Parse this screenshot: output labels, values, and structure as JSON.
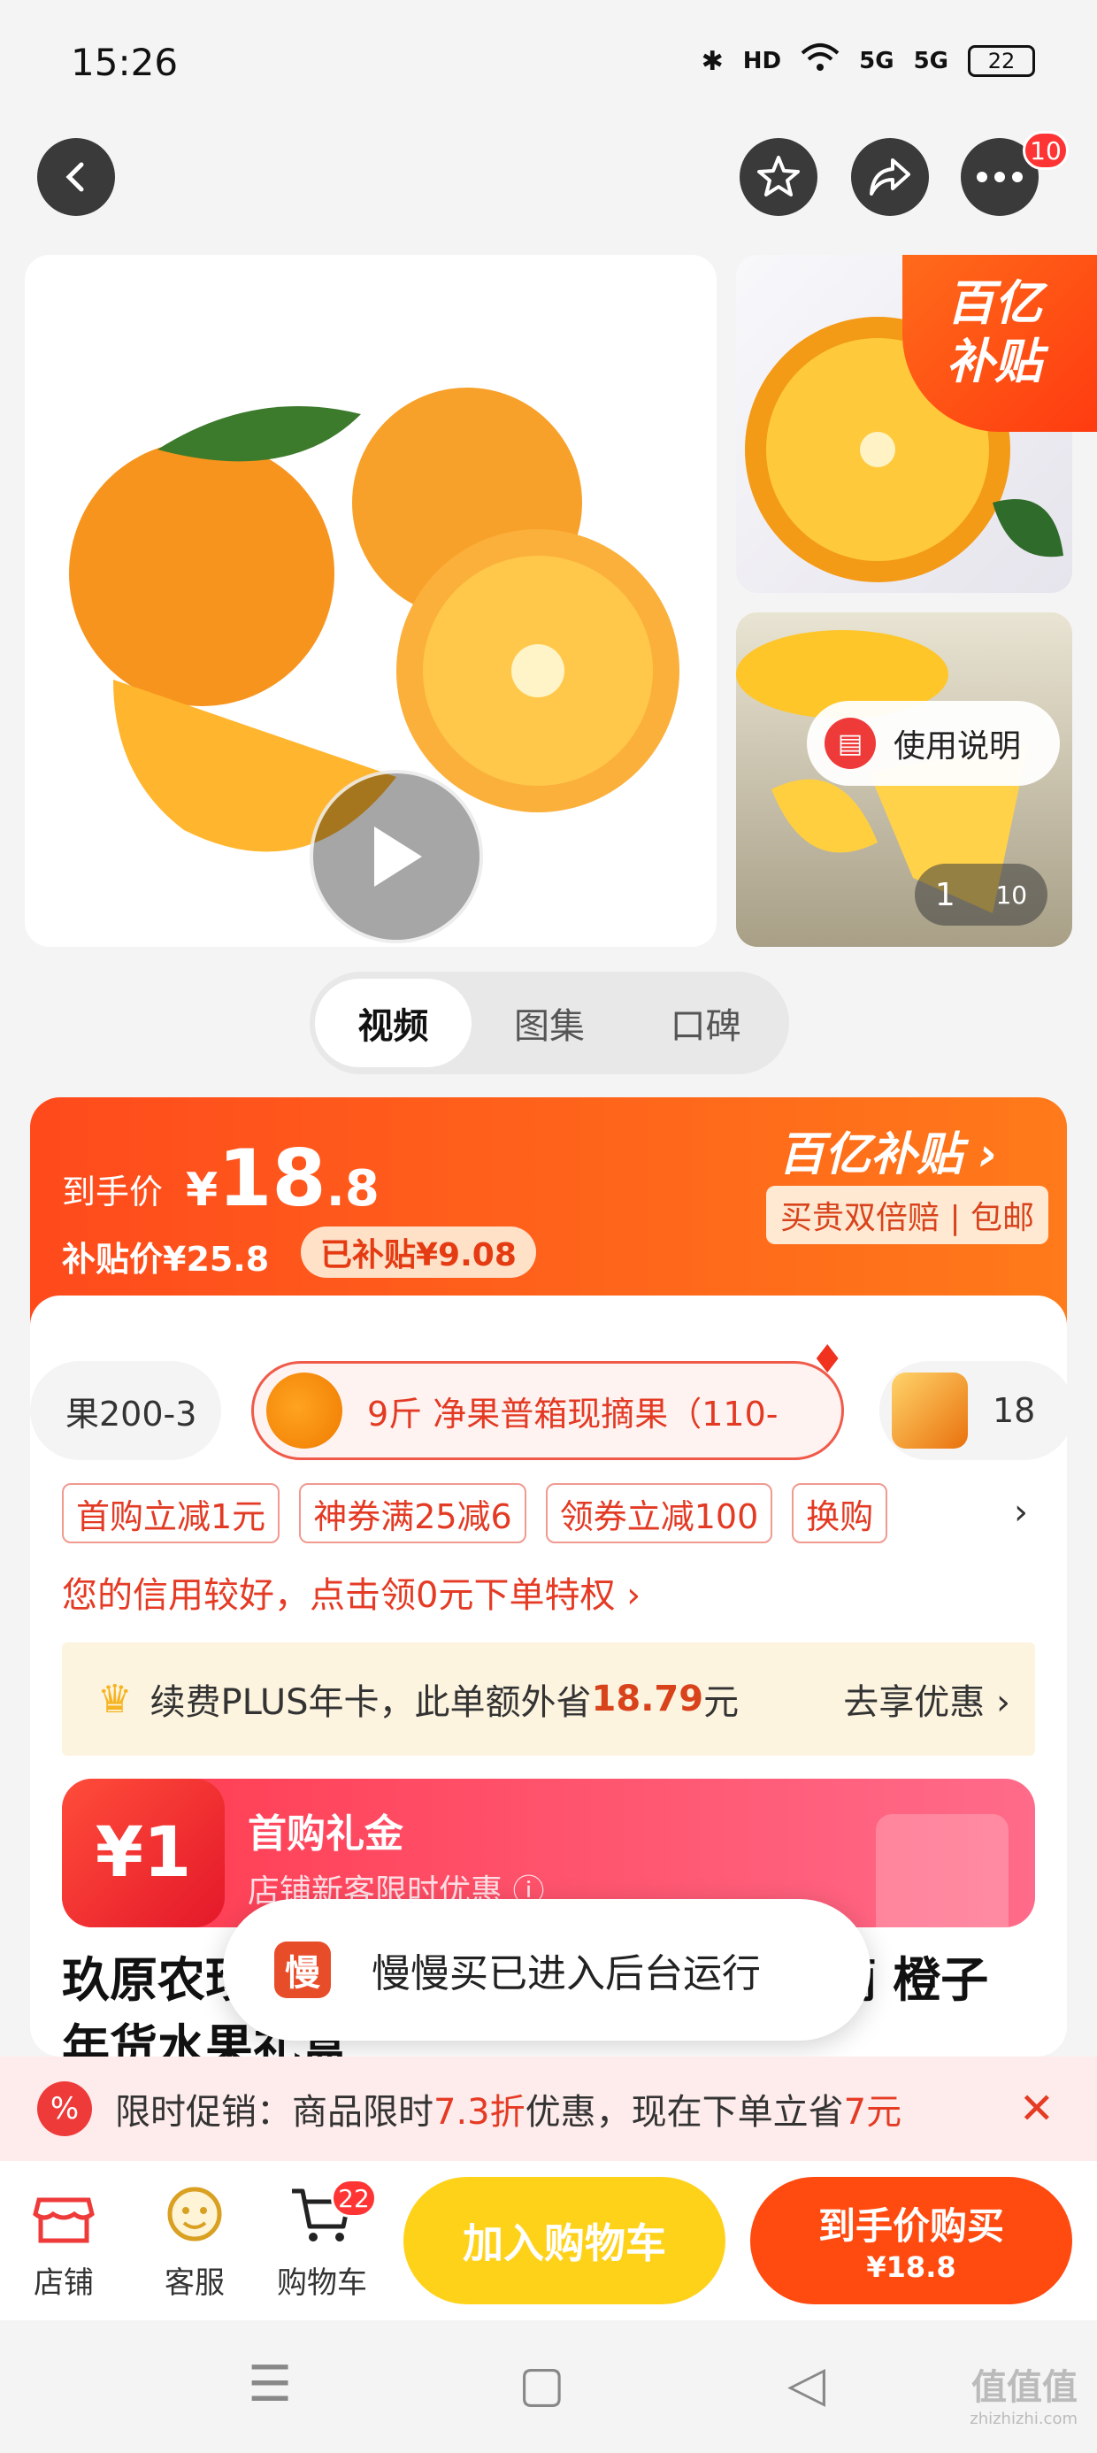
{
  "status_bar": {
    "time": "15:26",
    "bluetooth": "✱",
    "hd": "HD",
    "net1": "5G",
    "net2": "5G",
    "battery": "22"
  },
  "nav": {
    "back_icon": "back-arrow-icon",
    "favorite_icon": "star-icon",
    "share_icon": "share-icon",
    "more_icon": "more-icon",
    "more_badge": "10"
  },
  "gallery": {
    "subsidy_badge_line1": "百亿",
    "subsidy_badge_line2": "补贴",
    "manual_label": "使用说明",
    "counter_current": "1",
    "counter_total": "10"
  },
  "media_tabs": [
    {
      "label": "视频"
    },
    {
      "label": "图集"
    },
    {
      "label": "口碑"
    }
  ],
  "price": {
    "label": "到手价",
    "currency": "¥",
    "integer": "18",
    "decimal": ".8",
    "subsidy_price": "补贴价¥25.8",
    "subsidized": "已补贴¥9.08",
    "brand_logo": "百亿补贴 ›",
    "tags": "买贵双倍赔 | 包邮"
  },
  "specs": {
    "left": "果200-3",
    "selected": "9斤 净果普箱现摘果（110-",
    "right": "18"
  },
  "coupons": [
    {
      "label": "首购立减1元"
    },
    {
      "label": "神券满25减6"
    },
    {
      "label": "领券立减100"
    },
    {
      "label": "换购"
    }
  ],
  "credit_notice": "您的信用较好，点击领0元下单特权 ›",
  "plus": {
    "text_before": "续费PLUS年卡，此单额外省",
    "amount": "18.79",
    "unit": "元",
    "cta": "去享优惠 ›"
  },
  "gift": {
    "amount": "¥1",
    "title": "首购礼金",
    "subtitle": "店铺新客限时优惠 ⓘ"
  },
  "product_title": "玖原农珍 赣南脐橙 新鲜水果 当季现摘 橙子 年货水果礼盒",
  "toast": {
    "icon_char": "慢",
    "text": "慢慢买已进入后台运行"
  },
  "promo": {
    "icon": "%",
    "prefix": "限时促销：商品限时",
    "discount": "7.3折",
    "mid": "优惠，现在下单立省",
    "save": "7元",
    "close_icon": "close-icon"
  },
  "bottom_bar": {
    "store_label": "店铺",
    "service_label": "客服",
    "cart_label": "购物车",
    "cart_badge": "22",
    "add_to_cart": "加入购物车",
    "buy_label": "到手价购买",
    "buy_price": "¥18.8"
  },
  "watermark": {
    "text": "值值值",
    "url": "zhizhizhi.com"
  }
}
